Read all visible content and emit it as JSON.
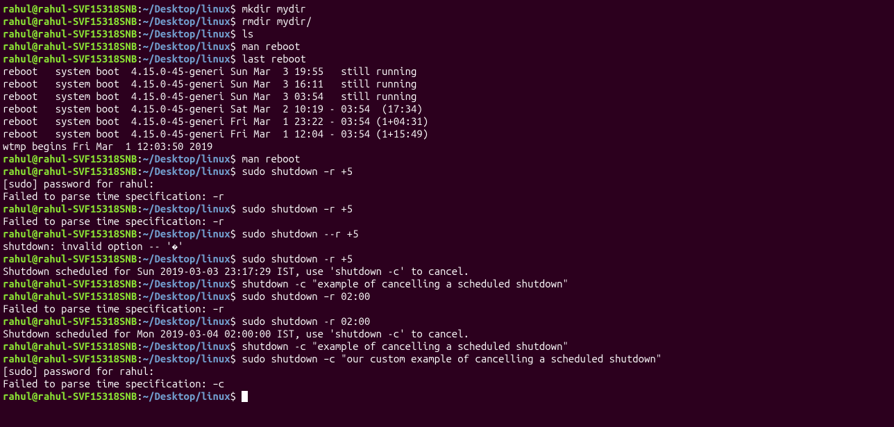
{
  "prompt": {
    "user": "rahul",
    "at": "@",
    "host": "rahul-SVF15318SNB",
    "colon": ":",
    "path": "~/Desktop/linux",
    "dollar": "$ "
  },
  "lines": [
    {
      "type": "prompt",
      "cmd": "mkdir mydir"
    },
    {
      "type": "prompt",
      "cmd": "rmdir mydir/"
    },
    {
      "type": "prompt",
      "cmd": "ls"
    },
    {
      "type": "prompt",
      "cmd": "man reboot"
    },
    {
      "type": "prompt",
      "cmd": "last reboot"
    },
    {
      "type": "output",
      "text": "reboot   system boot  4.15.0-45-generi Sun Mar  3 19:55   still running"
    },
    {
      "type": "output",
      "text": "reboot   system boot  4.15.0-45-generi Sun Mar  3 16:11   still running"
    },
    {
      "type": "output",
      "text": "reboot   system boot  4.15.0-45-generi Sun Mar  3 03:54   still running"
    },
    {
      "type": "output",
      "text": "reboot   system boot  4.15.0-45-generi Sat Mar  2 10:19 - 03:54  (17:34)"
    },
    {
      "type": "output",
      "text": "reboot   system boot  4.15.0-45-generi Fri Mar  1 23:22 - 03:54 (1+04:31)"
    },
    {
      "type": "output",
      "text": "reboot   system boot  4.15.0-45-generi Fri Mar  1 12:04 - 03:54 (1+15:49)"
    },
    {
      "type": "output",
      "text": ""
    },
    {
      "type": "output",
      "text": "wtmp begins Fri Mar  1 12:03:50 2019"
    },
    {
      "type": "prompt",
      "cmd": "man reboot"
    },
    {
      "type": "prompt",
      "cmd": "sudo shutdown –r +5"
    },
    {
      "type": "output",
      "text": "[sudo] password for rahul: "
    },
    {
      "type": "output",
      "text": "Failed to parse time specification: –r"
    },
    {
      "type": "prompt",
      "cmd": "sudo shutdown –r +5"
    },
    {
      "type": "output",
      "text": "Failed to parse time specification: –r"
    },
    {
      "type": "prompt",
      "cmd": "sudo shutdown --r +5"
    },
    {
      "type": "output",
      "text": "shutdown: invalid option -- '�'"
    },
    {
      "type": "prompt",
      "cmd": "sudo shutdown -r +5"
    },
    {
      "type": "output",
      "text": "Shutdown scheduled for Sun 2019-03-03 23:17:29 IST, use 'shutdown -c' to cancel."
    },
    {
      "type": "prompt",
      "cmd": "shutdown -c \"example of cancelling a scheduled shutdown\""
    },
    {
      "type": "prompt",
      "cmd": "sudo shutdown –r 02:00"
    },
    {
      "type": "output",
      "text": "Failed to parse time specification: –r"
    },
    {
      "type": "prompt",
      "cmd": "sudo shutdown -r 02:00"
    },
    {
      "type": "output",
      "text": "Shutdown scheduled for Mon 2019-03-04 02:00:00 IST, use 'shutdown -c' to cancel."
    },
    {
      "type": "prompt",
      "cmd": "shutdown -c \"example of cancelling a scheduled shutdown\""
    },
    {
      "type": "prompt",
      "cmd": "sudo shutdown –c \"our custom example of cancelling a scheduled shutdown\""
    },
    {
      "type": "output",
      "text": "[sudo] password for rahul: "
    },
    {
      "type": "output",
      "text": "Failed to parse time specification: –c"
    },
    {
      "type": "prompt-cursor",
      "cmd": ""
    }
  ]
}
